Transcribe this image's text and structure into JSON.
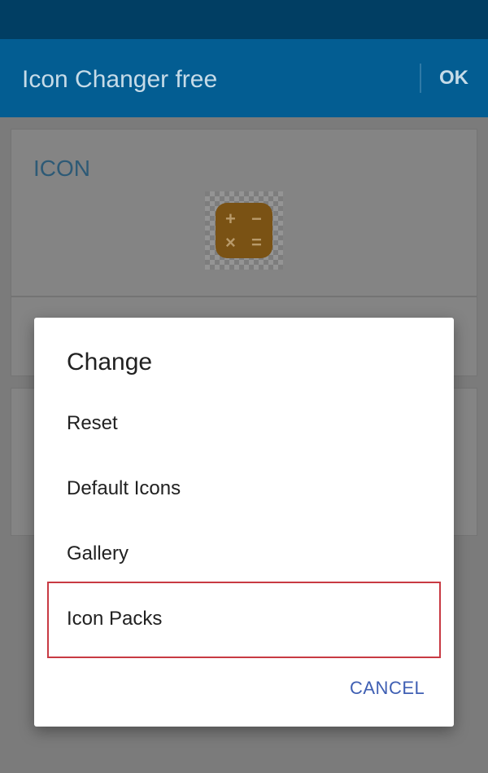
{
  "app_bar": {
    "title": "Icon Changer free",
    "ok_label": "OK"
  },
  "card": {
    "header": "ICON",
    "calc_symbols": {
      "plus": "+",
      "minus": "−",
      "times": "×",
      "equals": "="
    }
  },
  "dialog": {
    "title": "Change",
    "items": [
      {
        "label": "Reset"
      },
      {
        "label": "Default Icons"
      },
      {
        "label": "Gallery"
      },
      {
        "label": "Icon Packs"
      }
    ],
    "cancel_label": "CANCEL"
  },
  "colors": {
    "app_bar": "#035d92",
    "status_bar": "#013e63",
    "dialog_background": "#ffffff",
    "highlight_border": "#c83a43",
    "cancel_text": "#3f5fb3"
  }
}
